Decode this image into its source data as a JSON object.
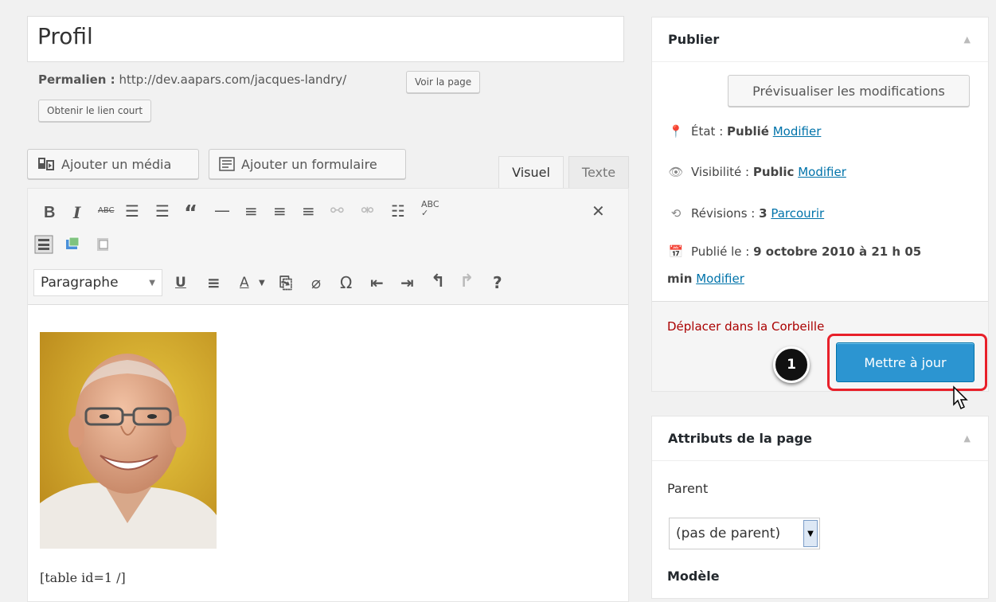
{
  "editor": {
    "title": "Profil",
    "permalink_label": "Permalien :",
    "permalink_url": "http://dev.aapars.com/jacques-landry/",
    "view_page": "Voir la page",
    "shortlink": "Obtenir le lien court",
    "add_media": "Ajouter un média",
    "add_form": "Ajouter un formulaire",
    "tab_visual": "Visuel",
    "tab_text": "Texte",
    "format_select": "Paragraphe",
    "shortcode": "[table id=1 /]"
  },
  "publish": {
    "title": "Publier",
    "preview": "Prévisualiser les modifications",
    "state_label": "État :",
    "state_value": "Publié",
    "visibility_label": "Visibilité :",
    "visibility_value": "Public",
    "revisions_label": "Révisions :",
    "revisions_value": "3",
    "browse": "Parcourir",
    "published_label": "Publié le :",
    "published_value": "9 octobre 2010 à 21 h 05",
    "published_value_cont": "min",
    "edit": "Modifier",
    "trash": "Déplacer dans la Corbeille",
    "update": "Mettre à jour"
  },
  "annotation": {
    "step": "1",
    "highlight_color": "#e8202a"
  },
  "attributes": {
    "title": "Attributs de la page",
    "parent_label": "Parent",
    "parent_value": "(pas de parent)",
    "template_label": "Modèle"
  },
  "colors": {
    "primary": "#2c95d1",
    "link": "#0073aa",
    "danger": "#a00"
  }
}
